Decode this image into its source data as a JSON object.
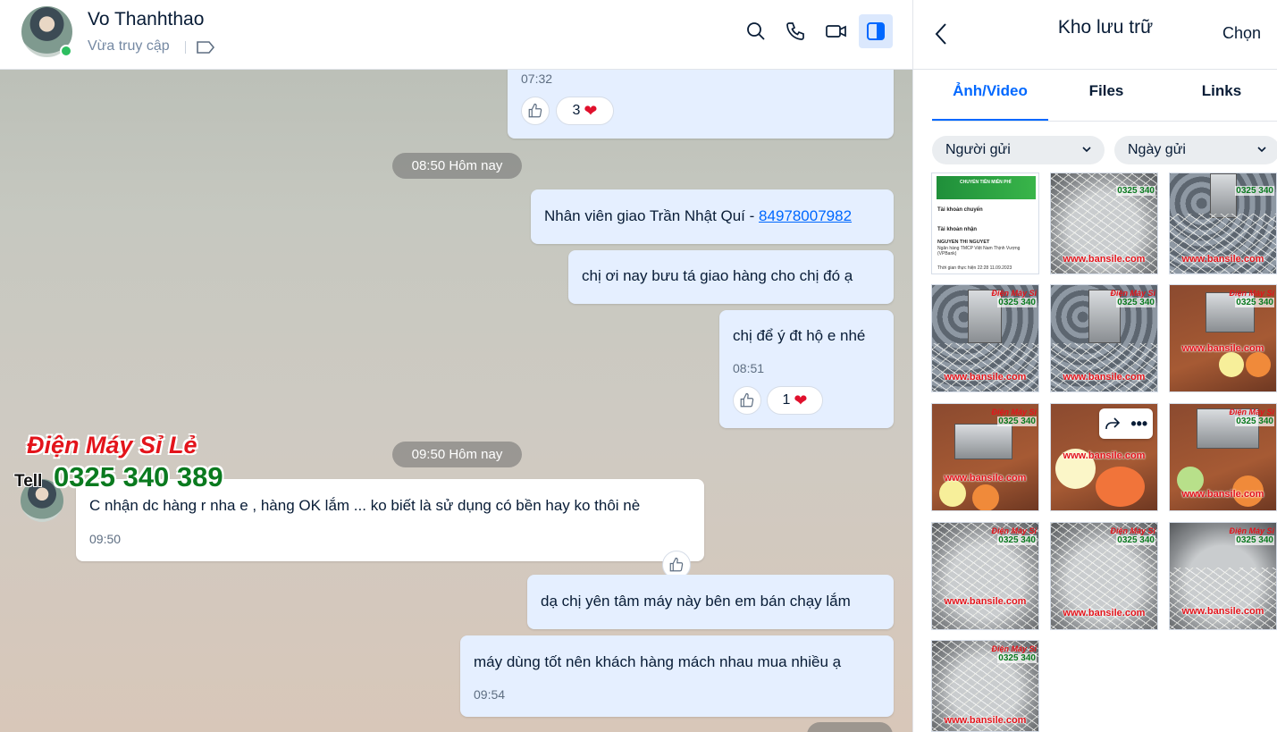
{
  "header": {
    "contact_name": "Vo Thanhthao",
    "status": "Vừa truy cập"
  },
  "messages": {
    "m0": {
      "time": "07:32",
      "reaction_count": "3"
    },
    "div1": "08:50 Hôm nay",
    "m1": {
      "text": "Nhân viên giao Trần Nhật Quí - ",
      "link": "84978007982"
    },
    "m2": {
      "text": "chị ơi nay bưu tá giao hàng cho chị đó ạ"
    },
    "m3": {
      "text": "chị để ý đt hộ e nhé",
      "time": "08:51",
      "reaction_count": "1"
    },
    "div2": "09:50 Hôm nay",
    "m4": {
      "text": "C nhận dc hàng r nha e , hàng OK lắm ... ko biết là sử dụng có bền hay ko thôi nè",
      "time": "09:50"
    },
    "m5": {
      "text": "dạ chị yên tâm máy này bên em bán chạy lắm"
    },
    "m6": {
      "text": "máy dùng tốt nên khách hàng mách nhau mua nhiều ạ",
      "time": "09:54"
    }
  },
  "watermark": {
    "name": "Điện Máy Sỉ Lẻ",
    "tell": "Tell",
    "phone": "0325 340 389"
  },
  "panel": {
    "title": "Kho lưu trữ",
    "choose": "Chọn",
    "tabs": [
      "Ảnh/Video",
      "Files",
      "Links"
    ],
    "filters": [
      "Người gửi",
      "Ngày gửi"
    ],
    "thumb_wm_name": "Điện Máy Sỉ",
    "thumb_wm_num": "0325 340",
    "thumb_wm_site": "www.bansile.com",
    "receipt": {
      "banner": "CHUYỂN TIỀN MIỄN PHÍ",
      "from_label": "Tài khoản chuyển",
      "to_label": "Tài khoản nhận",
      "recipient": "NGUYEN THI NGUYET",
      "bank": "Ngân hàng TMCP Việt Nam Thịnh Vượng (VPBank)",
      "time": "Thời gian thực hiện 22:28 11.09.2023"
    }
  },
  "colors": {
    "accent": "#0068ff",
    "outgoing_bubble": "#e5efff",
    "heart": "#e0102c",
    "online": "#2dbe60"
  }
}
